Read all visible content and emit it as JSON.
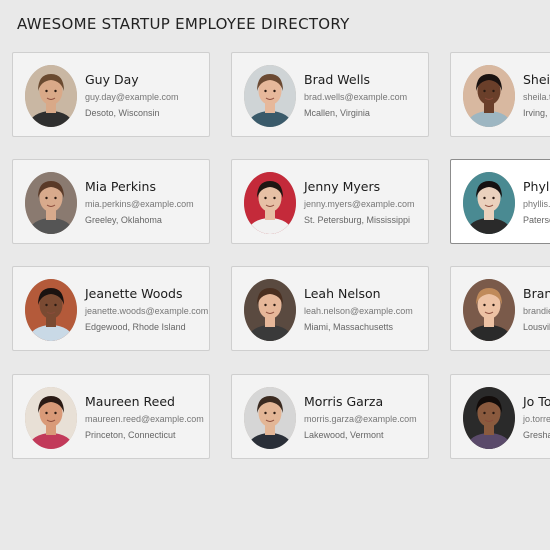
{
  "page": {
    "title": "AWESOME STARTUP EMPLOYEE DIRECTORY"
  },
  "employees": [
    {
      "name": "Guy Day",
      "email": "guy.day@example.com",
      "location": "Desoto, Wisconsin",
      "bg": "#c9b7a3",
      "skin": "#d9a988",
      "hair": "#6a4a30",
      "shirt": "#2f2f2f"
    },
    {
      "name": "Brad Wells",
      "email": "brad.wells@example.com",
      "location": "Mcallen, Virginia",
      "bg": "#cfd4d6",
      "skin": "#e6b89b",
      "hair": "#6b4a33",
      "shirt": "#3a5a6a"
    },
    {
      "name": "Sheila",
      "email": "sheila.th",
      "location": "Irving, C",
      "bg": "#d8b8a0",
      "skin": "#6a3f2a",
      "hair": "#1a1210",
      "shirt": "#9db6c2"
    },
    {
      "name": "Mia Perkins",
      "email": "mia.perkins@example.com",
      "location": "Greeley, Oklahoma",
      "bg": "#8a7a70",
      "skin": "#d8aa8c",
      "hair": "#5a3a28",
      "shirt": "#555555"
    },
    {
      "name": "Jenny Myers",
      "email": "jenny.myers@example.com",
      "location": "St. Petersburg, Mississippi",
      "bg": "#c42a3a",
      "skin": "#e7c0a5",
      "hair": "#1e1612",
      "shirt": "#f1f1f1"
    },
    {
      "name": "Phylli",
      "email": "phyllis.r",
      "location": "Paterso",
      "bg": "#4a8a92",
      "skin": "#ead1bd",
      "hair": "#161212",
      "shirt": "#2a2a2a"
    },
    {
      "name": "Jeanette Woods",
      "email": "jeanette.woods@example.com",
      "location": "Edgewood, Rhode Island",
      "bg": "#b45a3a",
      "skin": "#7a4a32",
      "hair": "#1a1210",
      "shirt": "#c9d9e6"
    },
    {
      "name": "Leah Nelson",
      "email": "leah.nelson@example.com",
      "location": "Miami, Massachusetts",
      "bg": "#5a4a40",
      "skin": "#e6b799",
      "hair": "#4a2f20",
      "shirt": "#3a3a3a"
    },
    {
      "name": "Branc",
      "email": "brandie.",
      "location": "Lousvill",
      "bg": "#7a5a4a",
      "skin": "#edc2a4",
      "hair": "#c08a5a",
      "shirt": "#2a2a2a"
    },
    {
      "name": "Maureen Reed",
      "email": "maureen.reed@example.com",
      "location": "Princeton, Connecticut",
      "bg": "#e8e0d6",
      "skin": "#d99a78",
      "hair": "#2a1a14",
      "shirt": "#c23a5a"
    },
    {
      "name": "Morris Garza",
      "email": "morris.garza@example.com",
      "location": "Lakewood, Vermont",
      "bg": "#d6d6d6",
      "skin": "#e3b696",
      "hair": "#3a2a20",
      "shirt": "#2a2f38"
    },
    {
      "name": "Jo Tor",
      "email": "jo.torres",
      "location": "Gresham",
      "bg": "#2a2a2a",
      "skin": "#8a5a3e",
      "hair": "#120c0a",
      "shirt": "#5a4a6a"
    }
  ],
  "active_card": "Phylli"
}
